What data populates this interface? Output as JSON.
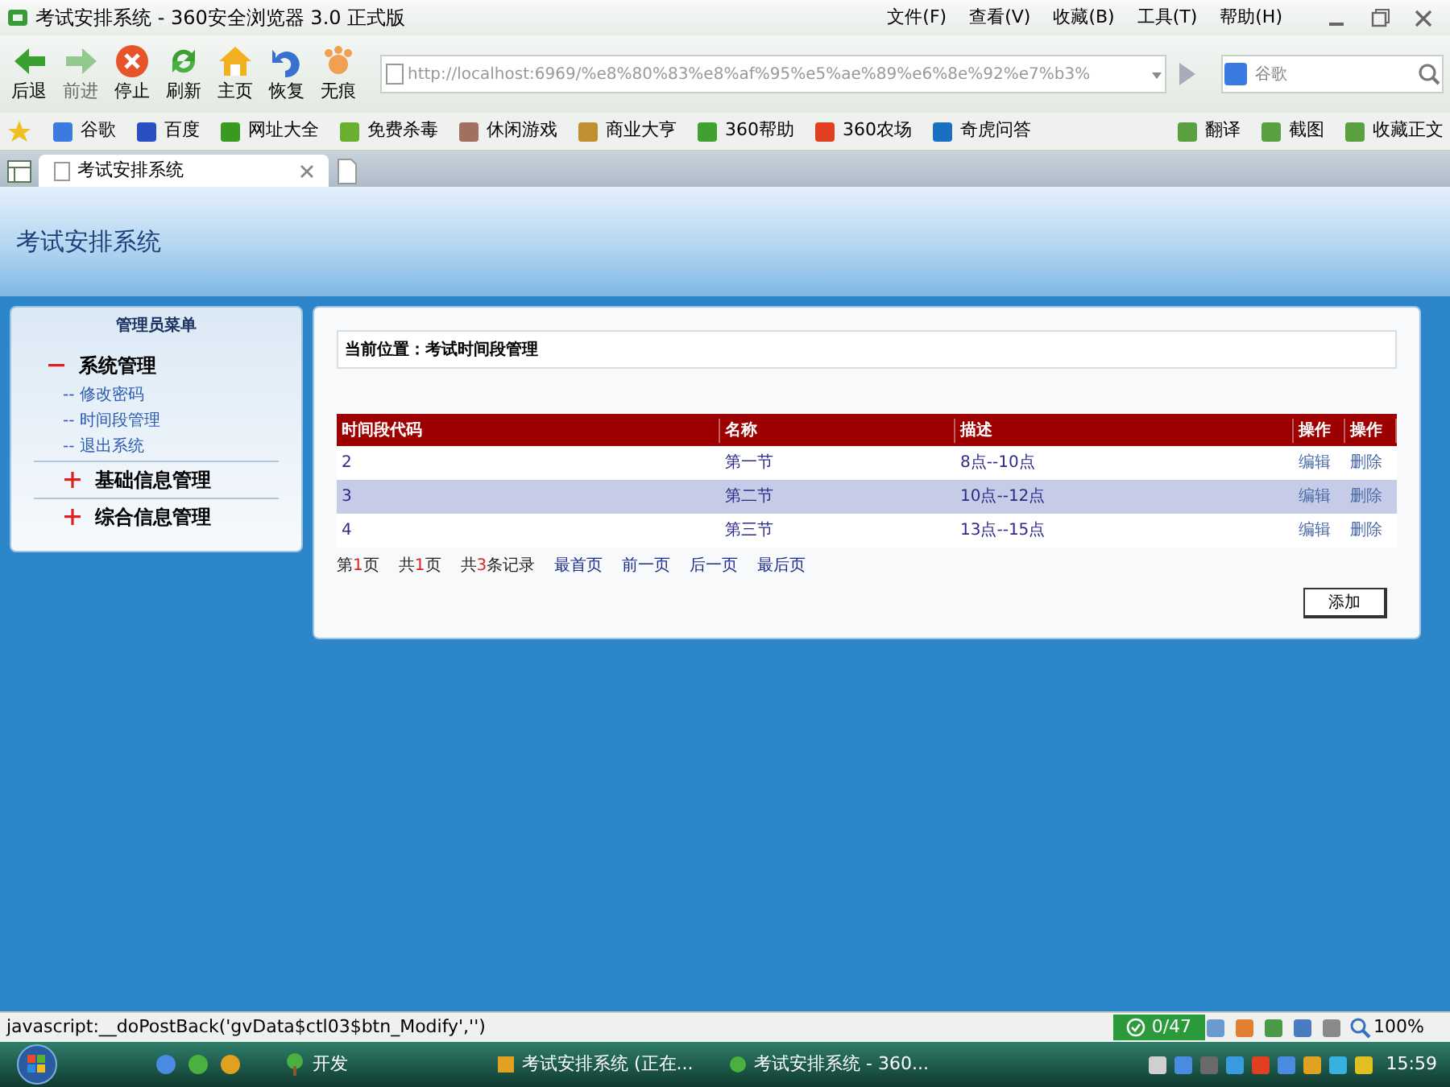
{
  "window": {
    "title": "考试安排系统 - 360安全浏览器 3.0 正式版",
    "menu": [
      "文件(F)",
      "查看(V)",
      "收藏(B)",
      "工具(T)",
      "帮助(H)"
    ]
  },
  "toolbar": [
    {
      "label": "后退",
      "kind": "back",
      "disabled": false
    },
    {
      "label": "前进",
      "kind": "forward",
      "disabled": true
    },
    {
      "label": "停止",
      "kind": "stop",
      "disabled": false
    },
    {
      "label": "刷新",
      "kind": "refresh",
      "disabled": false
    },
    {
      "label": "主页",
      "kind": "home",
      "disabled": false
    },
    {
      "label": "恢复",
      "kind": "undo",
      "disabled": false
    },
    {
      "label": "无痕",
      "kind": "paw",
      "disabled": false
    }
  ],
  "address_bar": {
    "url": "http://localhost:6969/%e8%80%83%e8%af%95%e5%ae%89%e6%8e%92%e7%b3%",
    "search_placeholder": "谷歌"
  },
  "bookmarks": [
    {
      "label": "谷歌",
      "color": "#3b7be0"
    },
    {
      "label": "百度",
      "color": "#2a4fc0"
    },
    {
      "label": "网址大全",
      "color": "#3a9a20"
    },
    {
      "label": "免费杀毒",
      "color": "#6ab030"
    },
    {
      "label": "休闲游戏",
      "color": "#a07060"
    },
    {
      "label": "商业大亨",
      "color": "#c09030"
    },
    {
      "label": "360帮助",
      "color": "#40a030"
    },
    {
      "label": "360农场",
      "color": "#e04020"
    },
    {
      "label": "奇虎问答",
      "color": "#1a70c0"
    }
  ],
  "bookmark_tools": [
    "翻译",
    "截图",
    "收藏正文"
  ],
  "tabs": [
    {
      "label": "考试安排系统",
      "selected": true
    }
  ],
  "page": {
    "title": "考试安排系统",
    "sidebar": {
      "title": "管理员菜单",
      "groups": [
        {
          "label": "系统管理",
          "expanded": true,
          "children": [
            "-- 修改密码",
            "-- 时间段管理",
            "-- 退出系统"
          ]
        },
        {
          "label": "基础信息管理",
          "expanded": false
        },
        {
          "label": "综合信息管理",
          "expanded": false
        }
      ]
    },
    "breadcrumb": "当前位置：考试时间段管理",
    "table": {
      "columns": [
        "时间段代码",
        "名称",
        "描述",
        "操作",
        "操作"
      ],
      "rows": [
        {
          "code": "2",
          "name": "第一节",
          "desc": "8点--10点",
          "edit": "编辑",
          "delete": "删除",
          "selected": false
        },
        {
          "code": "3",
          "name": "第二节",
          "desc": "10点--12点",
          "edit": "编辑",
          "delete": "删除",
          "selected": true
        },
        {
          "code": "4",
          "name": "第三节",
          "desc": "13点--15点",
          "edit": "编辑",
          "delete": "删除",
          "selected": false
        }
      ]
    },
    "pager": {
      "stats": [
        [
          {
            "kind": "text",
            "text": "第"
          },
          {
            "kind": "number",
            "text": "1"
          },
          {
            "kind": "text",
            "text": "页"
          }
        ],
        [
          {
            "kind": "text",
            "text": "共"
          },
          {
            "kind": "number",
            "text": "1"
          },
          {
            "kind": "text",
            "text": "页"
          }
        ],
        [
          {
            "kind": "text",
            "text": "共"
          },
          {
            "kind": "number",
            "text": "3"
          },
          {
            "kind": "text",
            "text": "条记录"
          }
        ]
      ],
      "links": [
        "最首页",
        "前一页",
        "后一页",
        "最后页"
      ]
    },
    "add_button": "添加"
  },
  "status_bar": {
    "text": "javascript:__doPostBack('gvData$ctl03$btn_Modify','')",
    "counter": "0/47",
    "zoom": "100%"
  },
  "taskbar": {
    "quick_launch": "开发",
    "tasks": [
      "考试安排系统 (正在...",
      "考试安排系统 - 360..."
    ],
    "clock": "15:59"
  }
}
